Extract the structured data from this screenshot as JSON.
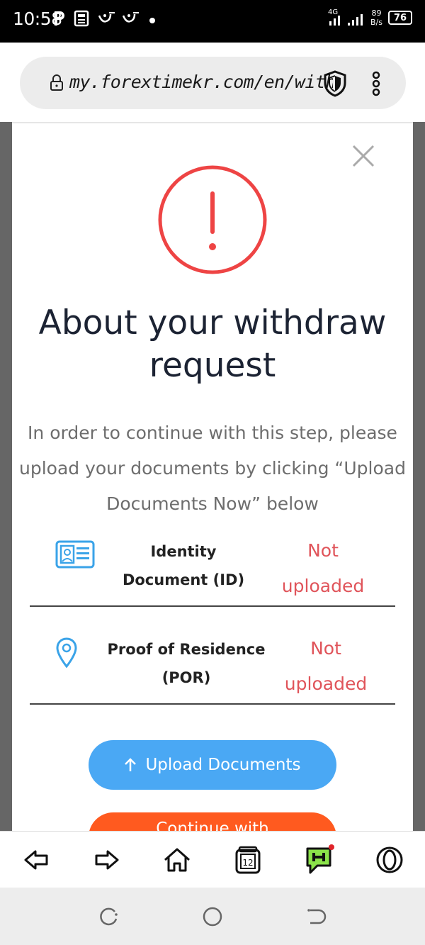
{
  "status_bar": {
    "time": "10:58",
    "network": "4G",
    "speed_value": "89",
    "speed_unit": "B/s",
    "battery": "76"
  },
  "browser": {
    "url": "my.forextimekr.com/en/withdra"
  },
  "modal": {
    "title": "About your withdraw request",
    "description": "In order to continue with this step, please upload your documents by clicking “Upload Documents Now” below",
    "documents": [
      {
        "label": "Identity Document (ID)",
        "status": "Not uploaded",
        "icon": "id-card-icon"
      },
      {
        "label": "Proof of Residence (POR)",
        "status": "Not uploaded",
        "icon": "location-pin-icon"
      }
    ],
    "upload_button": "Upload Documents",
    "continue_button": "Continue with"
  },
  "bottom_nav": {
    "tabs_count": "12"
  },
  "colors": {
    "alert": "#ee4444",
    "status_text": "#e0545a",
    "upload_button": "#4aa8f4",
    "continue_button": "#ff5a1f",
    "icon_blue": "#3aa3e8"
  }
}
